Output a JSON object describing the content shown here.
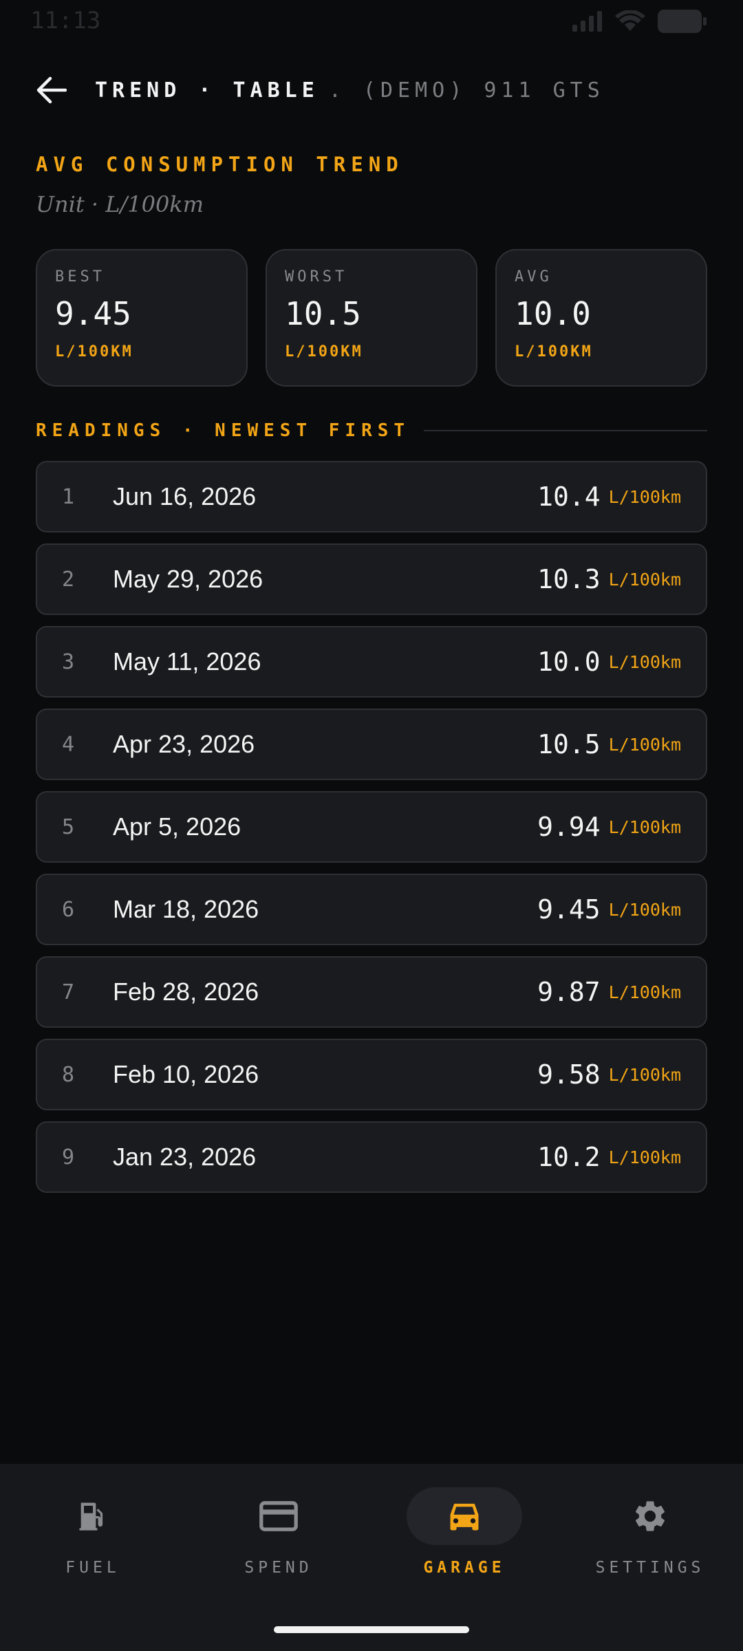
{
  "status_bar": {
    "time": "11:13"
  },
  "header": {
    "title": "TREND · TABLE",
    "subtitle": ". (DEMO) 911 GTS"
  },
  "section": {
    "title": "AVG CONSUMPTION TREND",
    "unit_line": "Unit · L/100km"
  },
  "stats": [
    {
      "label": "BEST",
      "value": "9.45",
      "unit": "L/100KM"
    },
    {
      "label": "WORST",
      "value": "10.5",
      "unit": "L/100KM"
    },
    {
      "label": "AVG",
      "value": "10.0",
      "unit": "L/100KM"
    }
  ],
  "readings": {
    "title": "READINGS · NEWEST FIRST",
    "unit": "L/100km",
    "rows": [
      {
        "index": "1",
        "date": "Jun 16, 2026",
        "value": "10.4"
      },
      {
        "index": "2",
        "date": "May 29, 2026",
        "value": "10.3"
      },
      {
        "index": "3",
        "date": "May 11, 2026",
        "value": "10.0"
      },
      {
        "index": "4",
        "date": "Apr 23, 2026",
        "value": "10.5"
      },
      {
        "index": "5",
        "date": "Apr 5, 2026",
        "value": "9.94"
      },
      {
        "index": "6",
        "date": "Mar 18, 2026",
        "value": "9.45"
      },
      {
        "index": "7",
        "date": "Feb 28, 2026",
        "value": "9.87"
      },
      {
        "index": "8",
        "date": "Feb 10, 2026",
        "value": "9.58"
      },
      {
        "index": "9",
        "date": "Jan 23, 2026",
        "value": "10.2"
      }
    ]
  },
  "nav": {
    "items": [
      {
        "label": "FUEL",
        "icon": "fuel-pump-icon"
      },
      {
        "label": "SPEND",
        "icon": "credit-card-icon"
      },
      {
        "label": "GARAGE",
        "icon": "car-icon",
        "active": true
      },
      {
        "label": "SETTINGS",
        "icon": "gear-icon"
      }
    ]
  },
  "colors": {
    "accent": "#f2a516",
    "background": "#0a0b0d",
    "card": "#1a1b1e",
    "muted": "#8a8b8f"
  }
}
